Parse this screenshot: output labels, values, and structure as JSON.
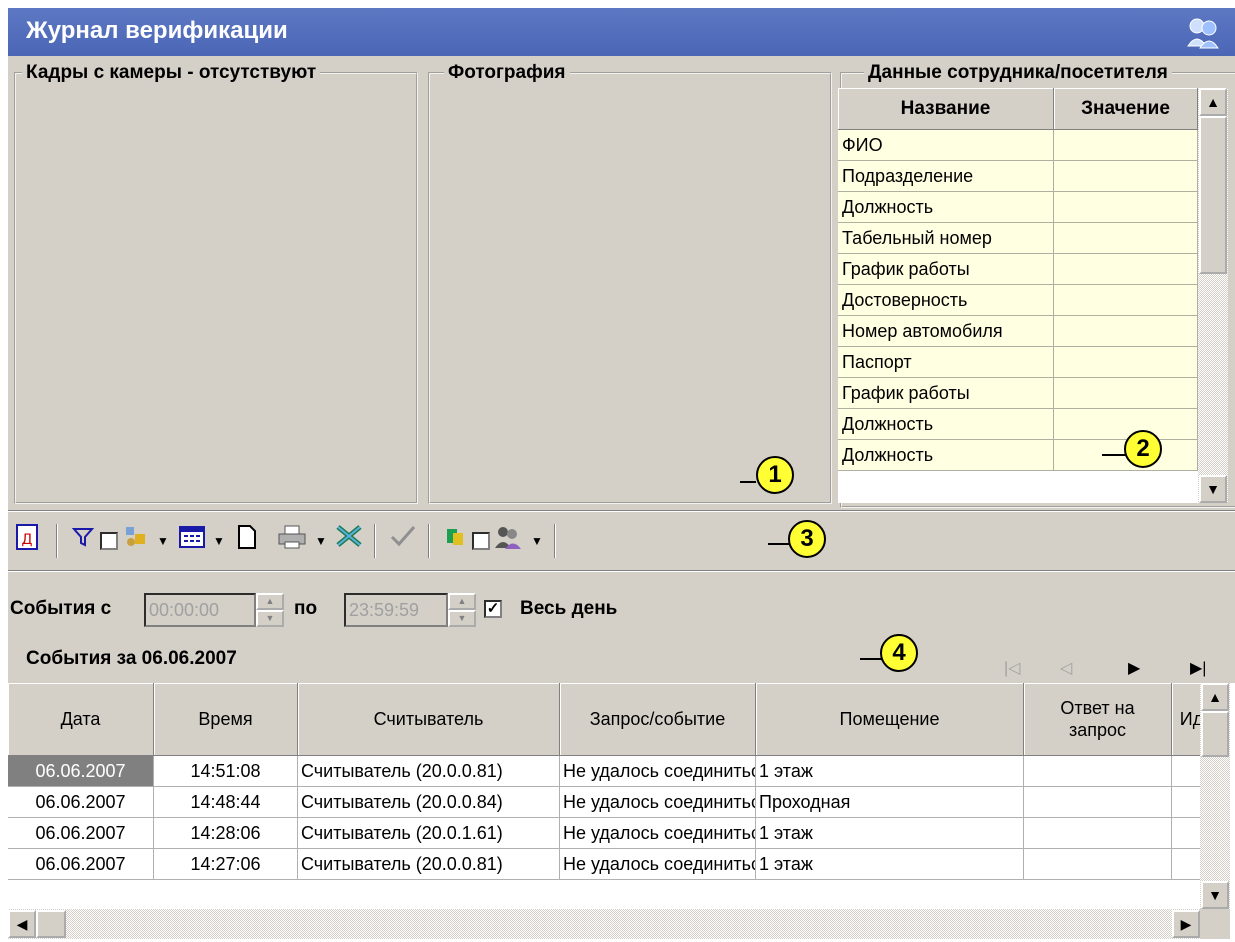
{
  "window": {
    "title": "Журнал верификации",
    "icon": "users-icon"
  },
  "panels": {
    "camera_title": "Кадры с камеры - отсутствуют",
    "photo_title": "Фотография",
    "info_title": "Данные сотрудника/посетителя"
  },
  "info_grid": {
    "headers": [
      "Название",
      "Значение"
    ],
    "rows": [
      "ФИО",
      "Подразделение",
      "Должность",
      "Табельный номер",
      "График работы",
      "Достоверность",
      "Номер автомобиля",
      "Паспорт",
      "График работы",
      "Должность",
      "Должность"
    ]
  },
  "callouts": [
    "1",
    "2",
    "3",
    "4"
  ],
  "toolbar": {
    "icons": [
      "report-icon",
      "filter-icon",
      "filter-checkbox",
      "settings-icon",
      "dropdown-arrow-icon",
      "calendar-icon",
      "dropdown-arrow-icon",
      "new-document-icon",
      "print-icon",
      "dropdown-arrow-icon",
      "excel-icon",
      "check-icon",
      "export-icon",
      "option-checkbox",
      "users-icon",
      "dropdown-arrow-icon"
    ]
  },
  "filter": {
    "from_label": "События с",
    "from_value": "00:00:00",
    "to_label": "по",
    "to_value": "23:59:59",
    "all_day_label": "Весь день",
    "all_day_checked": true
  },
  "events_title": "События за 06.06.2007",
  "nav_icons": [
    "first-page-icon",
    "prev-page-icon",
    "next-page-icon",
    "last-page-icon"
  ],
  "events_table": {
    "headers": [
      "Дата",
      "Время",
      "Считыватель",
      "Запрос/событие",
      "Помещение",
      "Ответ на запрос",
      "Ид"
    ],
    "rows": [
      [
        "06.06.2007",
        "14:51:08",
        "Считыватель (20.0.0.81)",
        "Не удалось соединиться",
        "1 этаж",
        "",
        ""
      ],
      [
        "06.06.2007",
        "14:48:44",
        "Считыватель (20.0.0.84)",
        "Не удалось соединиться",
        "Проходная",
        "",
        ""
      ],
      [
        "06.06.2007",
        "14:28:06",
        "Считыватель (20.0.1.61)",
        "Не удалось соединиться",
        "1 этаж",
        "",
        ""
      ],
      [
        "06.06.2007",
        "14:27:06",
        "Считыватель (20.0.0.81)",
        "Не удалось соединиться",
        "1 этаж",
        "",
        ""
      ]
    ]
  }
}
